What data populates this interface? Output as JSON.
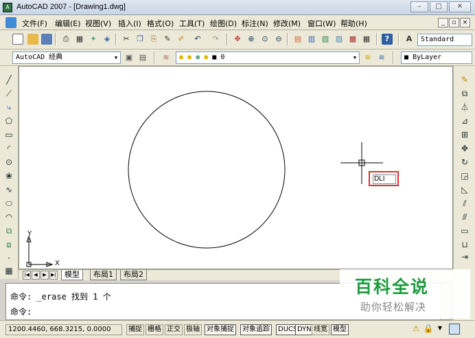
{
  "window": {
    "title": "AutoCAD 2007 - [Drawing1.dwg]",
    "buttons": [
      "–",
      "□",
      "✕"
    ]
  },
  "menu": {
    "items": [
      "文件(F)",
      "编辑(E)",
      "视图(V)",
      "插入(I)",
      "格式(O)",
      "工具(T)",
      "绘图(D)",
      "标注(N)",
      "修改(M)",
      "窗口(W)",
      "帮助(H)"
    ],
    "mdi_buttons": [
      "_",
      "▫",
      "×"
    ]
  },
  "toolbar_top": {
    "text_style": "Standard"
  },
  "toolbar_second": {
    "workspace": "AutoCAD 经典",
    "layer": "0",
    "linetype": "ByLayer"
  },
  "drawing": {
    "ucs_x": "X",
    "ucs_y": "Y",
    "dynamic_input": "DLI"
  },
  "layout_tabs": [
    "模型",
    "布局1",
    "布局2"
  ],
  "command": {
    "line1": "命令:  _erase 找到 1 个",
    "line2": "命令:"
  },
  "status": {
    "coords": "1200.4460, 668.3215, 0.0000",
    "toggles": [
      "捕捉",
      "栅格",
      "正交",
      "极轴",
      "对象捕捉",
      "对象追踪",
      "DUCS",
      "DYN",
      "线宽",
      "模型"
    ],
    "active_toggles": [
      "对象捕捉",
      "对象追踪",
      "DUCS",
      "DYN",
      "模型"
    ]
  },
  "watermark": {
    "main": "百科全说",
    "sub": "助你轻松解决"
  }
}
